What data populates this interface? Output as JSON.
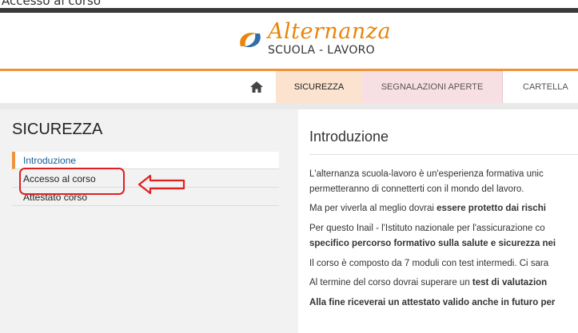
{
  "window_title": "Accesso al corso",
  "logo": {
    "script": "Alternanza",
    "subtitle": "SCUOLA - LAVORO"
  },
  "nav": {
    "home_icon": "home-icon",
    "tabs": [
      {
        "label": "SICUREZZA",
        "active": true
      },
      {
        "label": "SEGNALAZIONI APERTE",
        "active": false
      },
      {
        "label": "CARTELLA",
        "active": false
      }
    ]
  },
  "sidebar": {
    "title": "SICUREZZA",
    "items": [
      {
        "label": "Introduzione",
        "active": true
      },
      {
        "label": "Accesso al corso",
        "active": false
      },
      {
        "label": "Attestato corso",
        "active": false
      }
    ]
  },
  "main": {
    "title": "Introduzione",
    "paragraphs": {
      "p1_line1": "L'alternanza scuola-lavoro è un'esperienza formativa unic",
      "p1_line2": "permetteranno di connetterti con il mondo del lavoro.",
      "p2_text": "Ma per viverla al meglio dovrai ",
      "p2_bold": "essere protetto dai rischi",
      "p3_line1": "Per questo Inail - l'Istituto nazionale per l'assicurazione co",
      "p3_line2_bold": "specifico percorso formativo sulla salute e sicurezza nei",
      "p4": "Il corso è composto da 7 moduli con test intermedi. Ci sara",
      "p5_text": "Al termine del corso dovrai superare un ",
      "p5_bold": "test di valutazion",
      "p6_bold": "Alla fine riceverai un attestato valido anche in futuro per"
    }
  },
  "colors": {
    "accent_orange": "#f0923a",
    "logo_orange": "#e8850c",
    "link_blue": "#1a5d9a",
    "annotation_red": "#e02020"
  }
}
